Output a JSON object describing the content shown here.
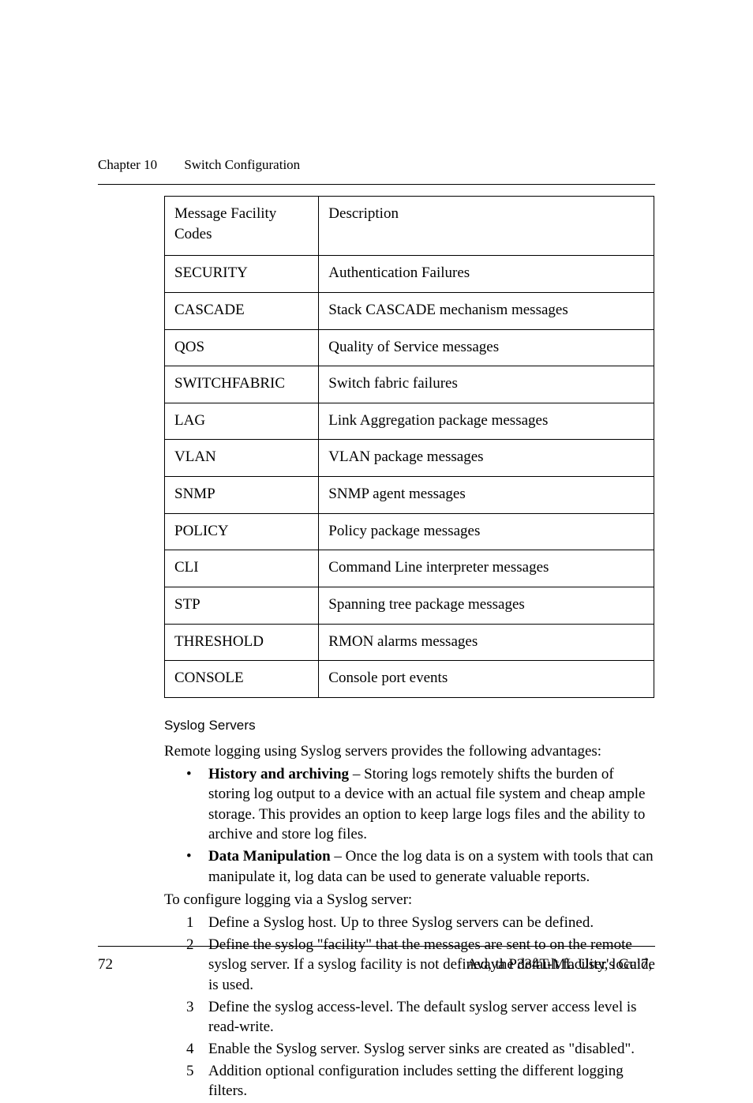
{
  "header": {
    "chapter": "Chapter 10",
    "title": "Switch Configuration"
  },
  "table": {
    "headers": {
      "code": "Message Facility Codes",
      "desc": "Description"
    },
    "rows": [
      {
        "code": "SECURITY",
        "desc": "Authentication Failures"
      },
      {
        "code": "CASCADE",
        "desc": "Stack CASCADE mechanism messages"
      },
      {
        "code": "QOS",
        "desc": "Quality of Service messages"
      },
      {
        "code": "SWITCHFABRIC",
        "desc": "Switch fabric failures"
      },
      {
        "code": "LAG",
        "desc": "Link Aggregation package messages"
      },
      {
        "code": "VLAN",
        "desc": "VLAN package messages"
      },
      {
        "code": "SNMP",
        "desc": "SNMP agent messages"
      },
      {
        "code": "POLICY",
        "desc": "Policy package messages"
      },
      {
        "code": "CLI",
        "desc": "Command Line interpreter messages"
      },
      {
        "code": "STP",
        "desc": "Spanning tree package messages"
      },
      {
        "code": "THRESHOLD",
        "desc": "RMON alarms messages"
      },
      {
        "code": "CONSOLE",
        "desc": "Console port events"
      }
    ]
  },
  "section": {
    "heading": "Syslog Servers",
    "intro": "Remote logging using Syslog servers provides the following advantages:",
    "bullets": [
      {
        "lead": "History and archiving",
        "rest": " – Storing logs remotely shifts the burden of storing log output to a device with an actual file system and cheap ample storage. This provides an option to keep large logs files and the ability to archive and store log files."
      },
      {
        "lead": "Data Manipulation",
        "rest": " – Once the log data is on a system with tools that can manipulate it, log data can be used to generate valuable reports."
      }
    ],
    "config_intro": "To configure logging via a Syslog server:",
    "steps": [
      "Define a Syslog host. Up to three Syslog servers can be defined.",
      "Define the syslog \"facility\" that the messages are sent to on the remote syslog server. If a syslog facility is not defined, the default facility, local7, is used.",
      "Define the syslog access-level. The default syslog server access level is read-write.",
      "Enable the Syslog server. Syslog server sinks are created as \"disabled\".",
      "Addition optional configuration includes setting the different logging filters."
    ]
  },
  "footer": {
    "page": "72",
    "book": "Avaya P334T-ML User's Guide"
  }
}
